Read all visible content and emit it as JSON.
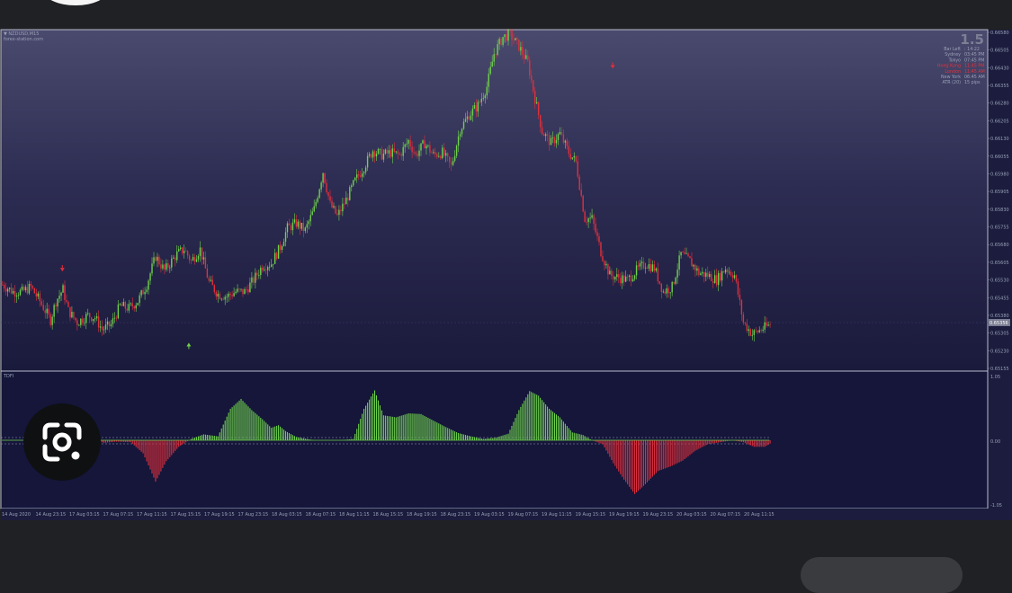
{
  "chart_header": {
    "symbol": "▼ NZDUSD,M15",
    "source": "forex-station.com",
    "indicator_label": "TDFI"
  },
  "info_panel": {
    "big_value": "1.5",
    "rows": [
      {
        "label": "Bar Left",
        "value": ": 14:22",
        "color": "#9aa0b5"
      },
      {
        "label": "Sydney",
        "value": "03:45 PM",
        "color": "#9aa0b5"
      },
      {
        "label": "Tokyo",
        "value": "07:45 PM",
        "color": "#9aa0b5"
      },
      {
        "label": "Hong Kong",
        "value": "11:45 PM",
        "color": "#e0343c"
      },
      {
        "label": "London",
        "value": "11:45 AM",
        "color": "#e0343c"
      },
      {
        "label": "New York",
        "value": "06:45 AM",
        "color": "#9aa0b5"
      },
      {
        "label": "ATR (20)",
        "value": "15 pips",
        "color": "#9aa0b5"
      }
    ]
  },
  "price_axis": [
    "0.66580",
    "0.66505",
    "0.66430",
    "0.66355",
    "0.66280",
    "0.66205",
    "0.66130",
    "0.66055",
    "0.65980",
    "0.65905",
    "0.65830",
    "0.65755",
    "0.65680",
    "0.65605",
    "0.65530",
    "0.65455",
    "0.65380",
    "0.65305",
    "0.65230",
    "0.65155"
  ],
  "current_price": "0.65356",
  "indicator_axis": {
    "top": "1.05",
    "mid": "0.00",
    "bottom": "-1.05"
  },
  "time_axis": [
    "14 Aug 2020",
    "14 Aug 23:15",
    "17 Aug 03:15",
    "17 Aug 07:15",
    "17 Aug 11:15",
    "17 Aug 15:15",
    "17 Aug 19:15",
    "17 Aug 23:15",
    "18 Aug 03:15",
    "18 Aug 07:15",
    "18 Aug 11:15",
    "18 Aug 15:15",
    "18 Aug 19:15",
    "18 Aug 23:15",
    "19 Aug 03:15",
    "19 Aug 07:15",
    "19 Aug 11:15",
    "19 Aug 15:15",
    "19 Aug 19:15",
    "19 Aug 23:15",
    "20 Aug 03:15",
    "20 Aug 07:15",
    "20 Aug 11:15"
  ],
  "colors": {
    "up": "#6fd14c",
    "down": "#e0303c",
    "text": "#9aa0b5",
    "panel_border": "#b8bccc"
  },
  "icons": {
    "lens": "google-lens-icon",
    "buy_arrow": "up-arrow-icon",
    "sell_arrow": "down-arrow-icon"
  },
  "chart_data": {
    "type": "candlestick",
    "symbol": "NZDUSD",
    "timeframe": "M15",
    "ylim": [
      0.65155,
      0.6658
    ],
    "price_path": [
      [
        0,
        0.6551
      ],
      [
        6,
        0.6548
      ],
      [
        11,
        0.6548
      ],
      [
        16,
        0.655
      ],
      [
        21,
        0.6544
      ],
      [
        27,
        0.6536
      ],
      [
        30,
        0.6544
      ],
      [
        34,
        0.6549
      ],
      [
        37,
        0.654
      ],
      [
        42,
        0.6535
      ],
      [
        48,
        0.6538
      ],
      [
        52,
        0.6537
      ],
      [
        56,
        0.6532
      ],
      [
        61,
        0.6534
      ],
      [
        66,
        0.6542
      ],
      [
        71,
        0.6541
      ],
      [
        76,
        0.6544
      ],
      [
        81,
        0.6551
      ],
      [
        86,
        0.6563
      ],
      [
        91,
        0.6557
      ],
      [
        98,
        0.6564
      ],
      [
        102,
        0.6566
      ],
      [
        106,
        0.6561
      ],
      [
        111,
        0.6566
      ],
      [
        116,
        0.6552
      ],
      [
        121,
        0.6547
      ],
      [
        126,
        0.6546
      ],
      [
        131,
        0.6548
      ],
      [
        136,
        0.6548
      ],
      [
        141,
        0.6553
      ],
      [
        146,
        0.6559
      ],
      [
        151,
        0.656
      ],
      [
        156,
        0.6567
      ],
      [
        160,
        0.6575
      ],
      [
        165,
        0.6577
      ],
      [
        170,
        0.6574
      ],
      [
        175,
        0.6583
      ],
      [
        180,
        0.6599
      ],
      [
        184,
        0.6585
      ],
      [
        188,
        0.658
      ],
      [
        193,
        0.6587
      ],
      [
        198,
        0.6595
      ],
      [
        203,
        0.6601
      ],
      [
        208,
        0.6608
      ],
      [
        213,
        0.6606
      ],
      [
        218,
        0.6607
      ],
      [
        223,
        0.6606
      ],
      [
        228,
        0.6612
      ],
      [
        232,
        0.6606
      ],
      [
        237,
        0.6611
      ],
      [
        242,
        0.6606
      ],
      [
        247,
        0.6607
      ],
      [
        252,
        0.6601
      ],
      [
        257,
        0.6617
      ],
      [
        262,
        0.6623
      ],
      [
        267,
        0.6627
      ],
      [
        272,
        0.6635
      ],
      [
        276,
        0.6649
      ],
      [
        281,
        0.6656
      ],
      [
        285,
        0.6657
      ],
      [
        290,
        0.6652
      ],
      [
        295,
        0.6645
      ],
      [
        299,
        0.663
      ],
      [
        303,
        0.6616
      ],
      [
        308,
        0.6611
      ],
      [
        313,
        0.6615
      ],
      [
        318,
        0.6607
      ],
      [
        322,
        0.6603
      ],
      [
        327,
        0.6579
      ],
      [
        331,
        0.6579
      ],
      [
        336,
        0.6565
      ],
      [
        341,
        0.6555
      ],
      [
        346,
        0.6554
      ],
      [
        351,
        0.6553
      ],
      [
        356,
        0.6557
      ],
      [
        361,
        0.656
      ],
      [
        366,
        0.6558
      ],
      [
        371,
        0.6548
      ],
      [
        376,
        0.655
      ],
      [
        381,
        0.6564
      ],
      [
        386,
        0.6561
      ],
      [
        391,
        0.6556
      ],
      [
        396,
        0.6555
      ],
      [
        401,
        0.6553
      ],
      [
        406,
        0.6558
      ],
      [
        411,
        0.6555
      ],
      [
        416,
        0.6535
      ],
      [
        421,
        0.653
      ],
      [
        426,
        0.6532
      ],
      [
        431,
        0.6534
      ]
    ],
    "tdfi_path": [
      [
        0,
        0.0
      ],
      [
        52,
        0.0
      ],
      [
        57,
        -0.04
      ],
      [
        64,
        -0.02
      ],
      [
        72,
        -0.03
      ],
      [
        79,
        -0.2
      ],
      [
        86,
        -0.63
      ],
      [
        92,
        -0.32
      ],
      [
        99,
        -0.1
      ],
      [
        106,
        0.02
      ],
      [
        113,
        0.09
      ],
      [
        121,
        0.06
      ],
      [
        128,
        0.48
      ],
      [
        134,
        0.63
      ],
      [
        140,
        0.46
      ],
      [
        146,
        0.32
      ],
      [
        151,
        0.19
      ],
      [
        155,
        0.23
      ],
      [
        159,
        0.14
      ],
      [
        165,
        0.05
      ],
      [
        175,
        0.0
      ],
      [
        190,
        0.0
      ],
      [
        197,
        0.02
      ],
      [
        203,
        0.48
      ],
      [
        209,
        0.76
      ],
      [
        214,
        0.38
      ],
      [
        221,
        0.35
      ],
      [
        228,
        0.41
      ],
      [
        235,
        0.4
      ],
      [
        242,
        0.3
      ],
      [
        249,
        0.2
      ],
      [
        256,
        0.11
      ],
      [
        263,
        0.06
      ],
      [
        270,
        0.02
      ],
      [
        277,
        0.04
      ],
      [
        284,
        0.1
      ],
      [
        290,
        0.46
      ],
      [
        296,
        0.75
      ],
      [
        301,
        0.68
      ],
      [
        307,
        0.48
      ],
      [
        313,
        0.35
      ],
      [
        320,
        0.12
      ],
      [
        326,
        0.08
      ],
      [
        331,
        0.0
      ],
      [
        337,
        -0.06
      ],
      [
        343,
        -0.35
      ],
      [
        349,
        -0.6
      ],
      [
        355,
        -0.82
      ],
      [
        361,
        -0.67
      ],
      [
        368,
        -0.47
      ],
      [
        375,
        -0.4
      ],
      [
        382,
        -0.31
      ],
      [
        389,
        -0.16
      ],
      [
        396,
        -0.06
      ],
      [
        403,
        -0.03
      ],
      [
        410,
        0.0
      ],
      [
        416,
        -0.03
      ],
      [
        422,
        -0.1
      ],
      [
        428,
        -0.1
      ],
      [
        431,
        -0.05
      ]
    ],
    "signal_arrows": [
      {
        "type": "sell",
        "bar": 34,
        "price": 0.6557
      },
      {
        "type": "buy",
        "bar": 105,
        "price": 0.6526
      },
      {
        "type": "sell",
        "bar": 343,
        "price": 0.6643
      }
    ]
  }
}
